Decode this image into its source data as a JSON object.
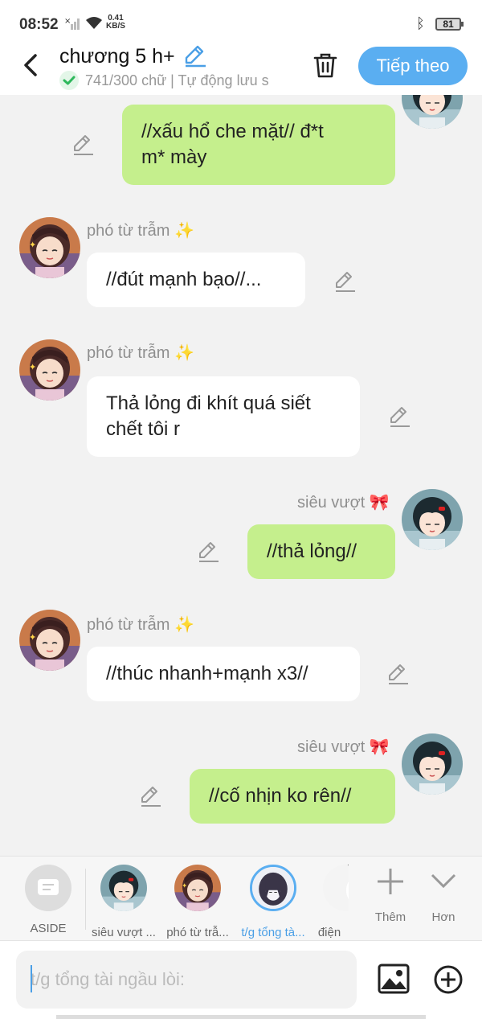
{
  "status": {
    "time": "08:52",
    "net_speed": "0.41",
    "net_unit": "KB/S",
    "battery": "81"
  },
  "header": {
    "title": "chương 5 h+",
    "subtitle": "741/300 chữ | Tự động lưu s",
    "next_label": "Tiếp theo"
  },
  "characters": {
    "a": {
      "name": "phó từ trẫm",
      "emoji": "✨"
    },
    "b": {
      "name": "siêu vượt",
      "emoji": "🎀"
    }
  },
  "messages": [
    {
      "speaker": "b",
      "side": "right",
      "text": "//xấu hổ che mặt// đ*t\nm* mày"
    },
    {
      "speaker": "a",
      "side": "left",
      "text": "//đút mạnh bạo//..."
    },
    {
      "speaker": "a",
      "side": "left",
      "text": "Thả lỏng đi khít quá siết\nchết tôi r"
    },
    {
      "speaker": "b",
      "side": "right",
      "text": "//thả lỏng//"
    },
    {
      "speaker": "a",
      "side": "left",
      "text": "//thúc nhanh+mạnh x3//"
    },
    {
      "speaker": "b",
      "side": "right",
      "text": "//cố nhịn ko rên//"
    }
  ],
  "role_bar": {
    "aside_label": "ASIDE",
    "roles": [
      "siêu vượt ...",
      "phó từ trẫ...",
      "t/g tổng tà...",
      "điện"
    ],
    "more_label": "Thêm",
    "less_label": "Hơn"
  },
  "input": {
    "placeholder": "t/g tổng tài ngầu lòi:"
  },
  "colors": {
    "accent": "#5aaef1",
    "bubble_right": "#c5ef8d",
    "bubble_left": "#ffffff"
  }
}
